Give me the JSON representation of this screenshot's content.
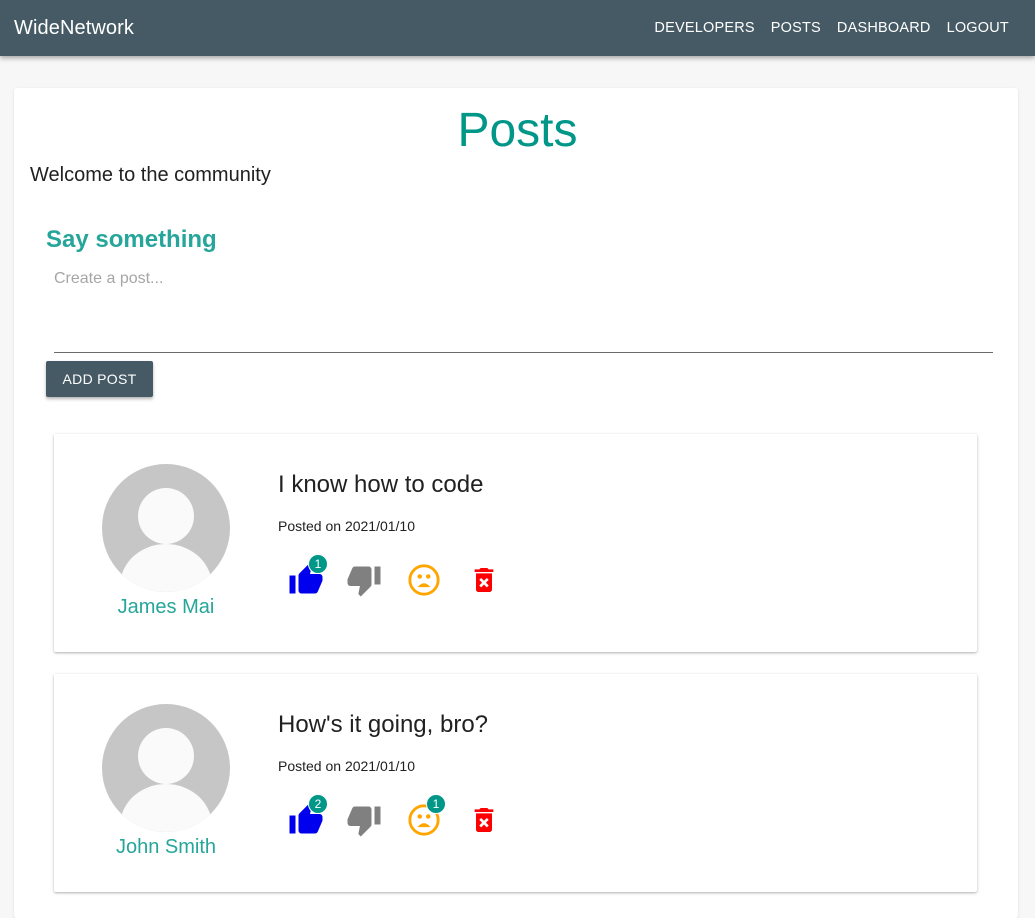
{
  "app": {
    "brand": "WideNetwork"
  },
  "nav": {
    "links": [
      {
        "label": "DEVELOPERS"
      },
      {
        "label": "POSTS"
      },
      {
        "label": "DASHBOARD"
      },
      {
        "label": "LOGOUT"
      }
    ]
  },
  "page": {
    "title": "Posts",
    "welcome": "Welcome to the community"
  },
  "composer": {
    "heading": "Say something",
    "placeholder": "Create a post...",
    "value": "",
    "submit_label": "ADD POST"
  },
  "colors": {
    "navbar": "#455a64",
    "accent": "#009688",
    "like": "#0000ee",
    "dislike": "#808080",
    "reaction": "#ffa500",
    "delete": "#ff0000"
  },
  "posts": [
    {
      "author": "James Mai",
      "text": "I know how to code",
      "date": "Posted on 2021/01/10",
      "likes": "1",
      "reactions": ""
    },
    {
      "author": "John Smith",
      "text": "How's it going, bro?",
      "date": "Posted on 2021/01/10",
      "likes": "2",
      "reactions": "1"
    }
  ],
  "icons": {
    "like": "thumbs-up-icon",
    "dislike": "thumbs-down-icon",
    "reaction": "emoji-icon",
    "delete": "trash-icon",
    "avatar": "user-avatar-placeholder"
  }
}
